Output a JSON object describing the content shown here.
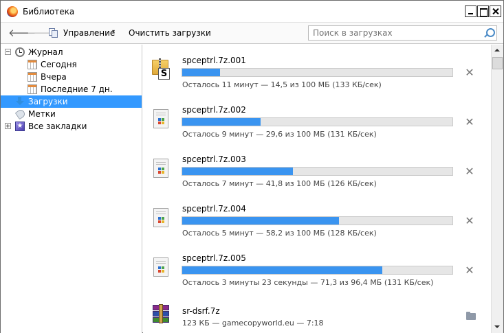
{
  "window": {
    "title": "Библиотека"
  },
  "toolbar": {
    "manage_label": "Управление",
    "manage_caret": "▾",
    "clear_label": "Очистить загрузки",
    "search_placeholder": "Поиск в загрузках"
  },
  "sidebar": {
    "journal": "Журнал",
    "today": "Сегодня",
    "yesterday": "Вчера",
    "last7": "Последние 7 дн.",
    "downloads": "Загрузки",
    "tags": "Метки",
    "all_bookmarks": "Все закладки"
  },
  "downloads": [
    {
      "name": "spceptrl.7z.001",
      "progress": 0.14,
      "status": "Осталось 11 минут — 14,5 из 100 МБ (133 КБ/сек)"
    },
    {
      "name": "spceptrl.7z.002",
      "progress": 0.29,
      "status": "Осталось 9 минут — 29,6 из 100 МБ (131 КБ/сек)"
    },
    {
      "name": "spceptrl.7z.003",
      "progress": 0.41,
      "status": "Осталось 7 минут — 41,8 из 100 МБ (126 КБ/сек)"
    },
    {
      "name": "spceptrl.7z.004",
      "progress": 0.58,
      "status": "Осталось 5 минут — 58,2 из 100 МБ (128 КБ/сек)"
    },
    {
      "name": "spceptrl.7z.005",
      "progress": 0.74,
      "status": "Осталось 3 минуты 23 секунды — 71,3 из 96,4 МБ (131 КБ/сек)"
    },
    {
      "name": "sr-dsrf.7z",
      "status": "123 КБ — gamecopyworld.eu — 7:18"
    }
  ],
  "icons": {
    "cancel_glyph": "✕",
    "back_glyph": "🡐",
    "forward_glyph": "🡒"
  },
  "colors": {
    "accent": "#3399ff",
    "progress": "#3a94f0"
  }
}
